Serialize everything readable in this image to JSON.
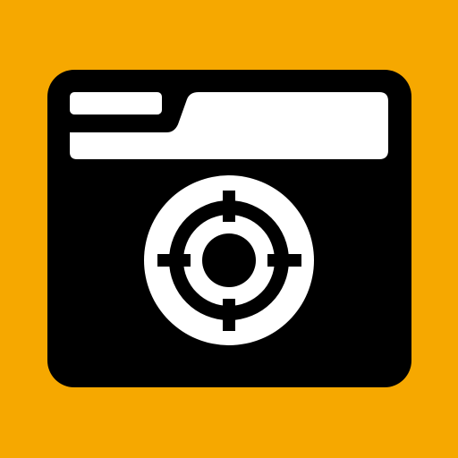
{
  "icon": {
    "name": "folder-location-target-icon",
    "colors": {
      "background": "#F6A800",
      "folder": "#000000",
      "foreground": "#FFFFFF"
    }
  }
}
